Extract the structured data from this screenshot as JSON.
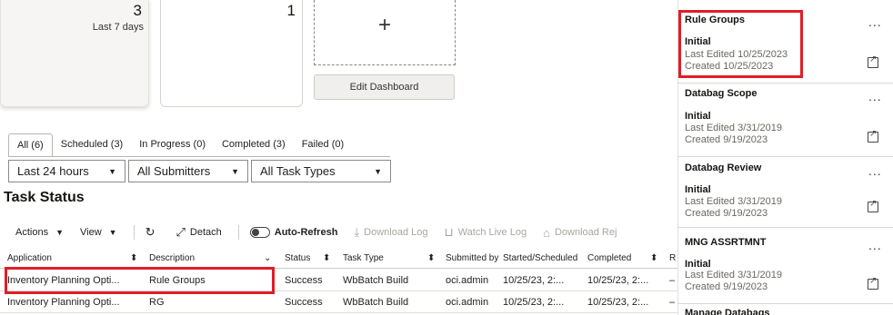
{
  "cards": [
    {
      "count": "3",
      "subtitle": "Last 7 days"
    },
    {
      "count": "1"
    }
  ],
  "add_tile": {
    "symbol": "+"
  },
  "edit_dashboard_label": "Edit Dashboard",
  "tabs": [
    {
      "label": "All (6)"
    },
    {
      "label": "Scheduled (3)"
    },
    {
      "label": "In Progress (0)"
    },
    {
      "label": "Completed (3)"
    },
    {
      "label": "Failed (0)"
    }
  ],
  "filters": {
    "time": "Last 24 hours",
    "submitters": "All Submitters",
    "task_types": "All Task Types"
  },
  "section_title": "Task Status",
  "toolbar": {
    "actions": "Actions",
    "view": "View",
    "detach": "Detach",
    "auto_refresh": "Auto-Refresh",
    "download_log": "Download Log",
    "watch_live_log": "Watch Live Log",
    "download_rej": "Download Rej"
  },
  "table": {
    "headers": [
      "Application",
      "Description",
      "Status",
      "Task Type",
      "Submitted by",
      "Started/Scheduled",
      "Completed",
      "R"
    ],
    "rows": [
      [
        "Inventory Planning Opti...",
        "Rule Groups",
        "Success",
        "WbBatch Build",
        "oci.admin",
        "10/25/23, 2:...",
        "10/25/23, 2:...",
        "–"
      ],
      [
        "Inventory Planning Opti...",
        "RG",
        "Success",
        "WbBatch Build",
        "oci.admin",
        "10/25/23, 2:...",
        "10/25/23, 2:...",
        "–"
      ]
    ]
  },
  "panel": {
    "items": [
      {
        "title": "Rule Groups",
        "state": "Initial",
        "edited": "Last Edited 10/25/2023",
        "created": "Created 10/25/2023"
      },
      {
        "title": "Databag Scope",
        "state": "Initial",
        "edited": "Last Edited 3/31/2019",
        "created": "Created 9/19/2023"
      },
      {
        "title": "Databag Review",
        "state": "Initial",
        "edited": "Last Edited 3/31/2019",
        "created": "Created 9/19/2023"
      },
      {
        "title": "MNG ASSRTMNT",
        "state": "Initial",
        "edited": "Last Edited 3/31/2019",
        "created": "Created 9/19/2023"
      },
      {
        "title": "Manage Databags"
      }
    ],
    "more_symbol": "..."
  },
  "colors": {
    "highlight": "#e11d26"
  }
}
